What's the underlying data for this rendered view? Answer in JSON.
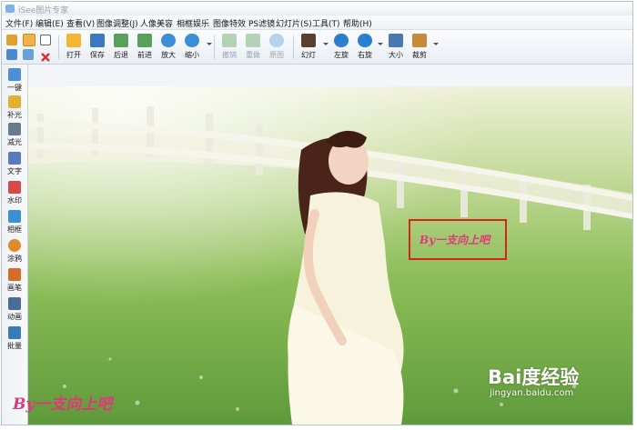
{
  "window": {
    "title": "iSee图片专家"
  },
  "menu": [
    "文件(F)",
    "编辑(E)",
    "查看(V)",
    "图像调整(J)",
    "人像美容",
    "相框娱乐",
    "图像特效",
    "PS滤镜",
    "幻灯片(S)",
    "工具(T)",
    "帮助(H)"
  ],
  "toolbar": [
    {
      "label": "打开",
      "icon": "folder-open-icon",
      "color": "#f2b632"
    },
    {
      "label": "保存",
      "icon": "floppy-disk-icon",
      "color": "#3b78c4"
    },
    {
      "label": "后退",
      "icon": "image-prev-icon",
      "color": "#5aa05a"
    },
    {
      "label": "前进",
      "icon": "image-next-icon",
      "color": "#5aa05a"
    },
    {
      "label": "放大",
      "icon": "zoom-in-icon",
      "color": "#3a8fd8"
    },
    {
      "label": "缩小",
      "icon": "zoom-out-icon",
      "color": "#3a8fd8"
    },
    {
      "label": "撤销",
      "icon": "undo-arrow-icon",
      "color": "#7db37d",
      "disabled": true
    },
    {
      "label": "重做",
      "icon": "redo-arrow-icon",
      "color": "#7db37d",
      "disabled": true
    },
    {
      "label": "原图",
      "icon": "original-image-icon",
      "color": "#9ac3e6",
      "disabled": true
    },
    {
      "label": "幻灯",
      "icon": "slideshow-icon",
      "color": "#5a4030"
    },
    {
      "label": "左旋",
      "icon": "rotate-left-icon",
      "color": "#2a7fd0"
    },
    {
      "label": "右旋",
      "icon": "rotate-right-icon",
      "color": "#2a7fd0"
    },
    {
      "label": "大小",
      "icon": "resize-icon",
      "color": "#4a78b0"
    },
    {
      "label": "裁剪",
      "icon": "crop-icon",
      "color": "#c58a3a"
    }
  ],
  "sidebar": [
    {
      "label": "一键",
      "icon": "one-click-icon",
      "color": "#4a8fd8"
    },
    {
      "label": "补光",
      "icon": "fill-light-icon",
      "color": "#e0b030"
    },
    {
      "label": "减光",
      "icon": "reduce-light-icon",
      "color": "#6a7a8a"
    },
    {
      "label": "文字",
      "icon": "text-icon",
      "color": "#5a7ac0"
    },
    {
      "label": "水印",
      "icon": "watermark-icon",
      "color": "#d84a4a"
    },
    {
      "label": "相框",
      "icon": "photo-frame-icon",
      "color": "#3a8fd8"
    },
    {
      "label": "涂鸦",
      "icon": "doodle-icon",
      "color": "#e08a2a"
    },
    {
      "label": "画笔",
      "icon": "brush-icon",
      "color": "#d86a2a"
    },
    {
      "label": "动画",
      "icon": "animation-icon",
      "color": "#4a6a9a"
    },
    {
      "label": "批量",
      "icon": "batch-icon",
      "color": "#3a7ab8"
    }
  ],
  "canvas": {
    "watermark_text": "By一支向上吧",
    "bottom_left_text": "By一支向上吧",
    "highlight_color": "#d9221f"
  },
  "source_watermark": {
    "main": "Bai度经验",
    "sub": "jingyan.baidu.com"
  }
}
